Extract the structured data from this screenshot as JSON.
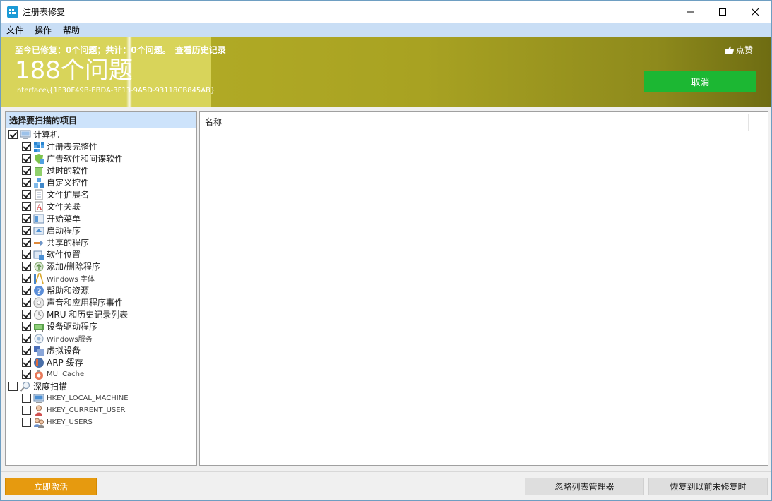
{
  "window": {
    "title": "注册表修复",
    "controls": {
      "minimize": "—",
      "maximize": "☐",
      "close": "✕"
    }
  },
  "menu": [
    "文件",
    "操作",
    "帮助"
  ],
  "banner": {
    "summary": "至今已修复：0个问题；共计：0个问题。",
    "history_link": "查看历史记录",
    "count": "188个问题",
    "path": "Interface\\{1F30F49B-EBDA-3F13-9A5D-93118CB845AB}",
    "like": "点赞",
    "cancel": "取消",
    "colors": {
      "accent": "#b8b128",
      "cancel": "#1cb733"
    }
  },
  "left_panel": {
    "header": "选择要扫描的项目",
    "root": {
      "label": "计算机",
      "checked": true,
      "icon": "computer-icon"
    },
    "items": [
      {
        "label": "注册表完整性",
        "icon": "registry-grid-icon",
        "small": false
      },
      {
        "label": "广告软件和间谍软件",
        "icon": "shield-icon",
        "small": false
      },
      {
        "label": "过时的软件",
        "icon": "trash-icon",
        "small": false
      },
      {
        "label": "自定义控件",
        "icon": "controls-icon",
        "small": false
      },
      {
        "label": "文件扩展名",
        "icon": "file-extension-icon",
        "small": false
      },
      {
        "label": "文件关联",
        "icon": "file-association-icon",
        "small": false
      },
      {
        "label": "开始菜单",
        "icon": "start-menu-icon",
        "small": false
      },
      {
        "label": "启动程序",
        "icon": "startup-icon",
        "small": false
      },
      {
        "label": "共享的程序",
        "icon": "shared-program-icon",
        "small": false
      },
      {
        "label": "软件位置",
        "icon": "software-location-icon",
        "small": false
      },
      {
        "label": "添加/删除程序",
        "icon": "add-remove-icon",
        "small": false
      },
      {
        "label": "Windows 字体",
        "icon": "font-icon",
        "small": true
      },
      {
        "label": "帮助和资源",
        "icon": "help-icon",
        "small": false
      },
      {
        "label": "声音和应用程序事件",
        "icon": "sound-icon",
        "small": false
      },
      {
        "label": "MRU 和历史记录列表",
        "icon": "history-icon",
        "small": false
      },
      {
        "label": "设备驱动程序",
        "icon": "driver-icon",
        "small": false
      },
      {
        "label": "Windows服务",
        "icon": "service-icon",
        "small": true
      },
      {
        "label": "虚拟设备",
        "icon": "virtual-device-icon",
        "small": false
      },
      {
        "label": "ARP 缓存",
        "icon": "arp-cache-icon",
        "small": false
      },
      {
        "label": "MUI Cache",
        "icon": "mui-cache-icon",
        "small": true
      }
    ],
    "deep_scan": {
      "label": "深度扫描",
      "checked": false,
      "icon": "magnifier-icon"
    },
    "deep_items": [
      {
        "label": "HKEY_LOCAL_MACHINE",
        "icon": "machine-icon"
      },
      {
        "label": "HKEY_CURRENT_USER",
        "icon": "user-icon"
      },
      {
        "label": "HKEY_USERS",
        "icon": "users-icon"
      }
    ]
  },
  "right_panel": {
    "column_name": "名称"
  },
  "footer": {
    "activate": "立即激活",
    "ignore_list": "忽略列表管理器",
    "restore": "恢复到以前未修复时"
  }
}
